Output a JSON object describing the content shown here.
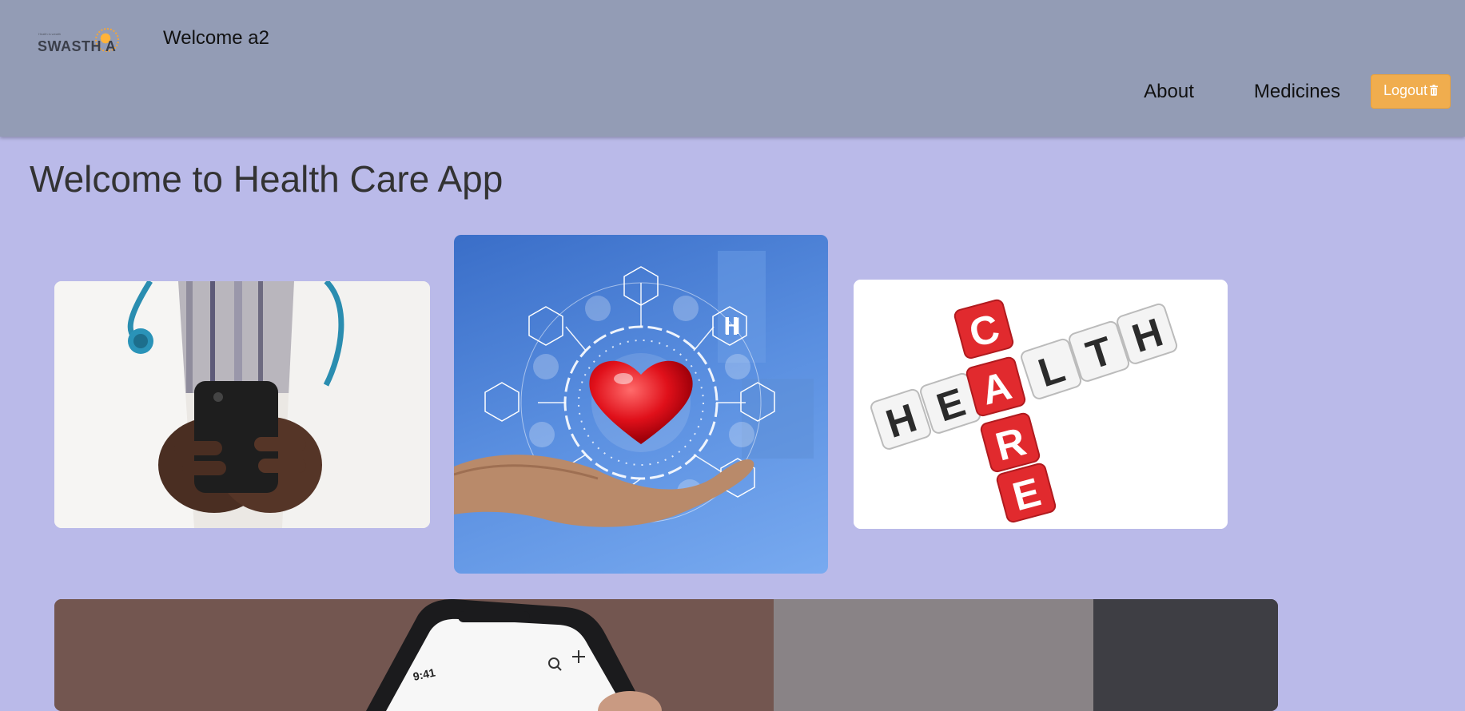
{
  "header": {
    "logo": {
      "tagline": "Health is wealth",
      "text": "SWASTH A"
    },
    "welcome_text": "Welcome a2",
    "nav": {
      "about": "About",
      "medicines": "Medicines",
      "logout": "Logout",
      "logout_icon": "trash-icon"
    },
    "colors": {
      "header_bg": "#939cb5",
      "logout_bg": "#f0ad4e"
    }
  },
  "main": {
    "title": "Welcome to Health Care App",
    "background": "#babae9",
    "images": [
      {
        "name": "doctor-with-phone-image",
        "description": ""
      },
      {
        "name": "hand-heart-health-icons-image",
        "description": ""
      },
      {
        "name": "health-care-crossword-image",
        "description": "",
        "letters_across": "HEALTH",
        "letters_down": "CARE"
      },
      {
        "name": "hand-holding-smartphone-image",
        "description": "",
        "phone_time": "9:41"
      }
    ]
  }
}
